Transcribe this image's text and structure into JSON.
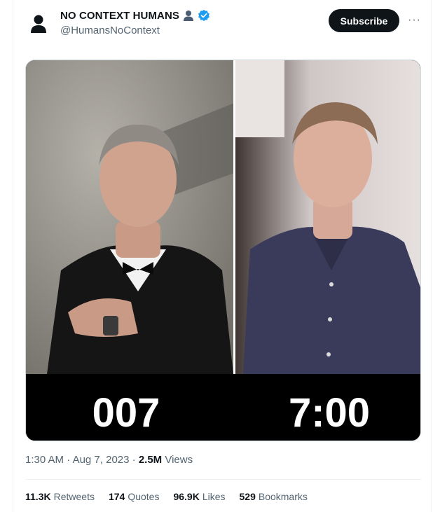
{
  "author": {
    "display_name": "NO CONTEXT HUMANS",
    "handle": "@HumansNoContext",
    "name_emoji": "person-silhouette-icon",
    "verified": true
  },
  "header": {
    "subscribe_label": "Subscribe",
    "more_icon": "more-options-icon",
    "more_glyph": "···"
  },
  "media": {
    "left_caption": "007",
    "right_caption": "7:00",
    "colors": {
      "caption_bg": "#000000",
      "caption_text": "#ffffff"
    }
  },
  "meta": {
    "time": "1:30 AM",
    "sep": "·",
    "date": "Aug 7, 2023",
    "views_count": "2.5M",
    "views_label": "Views"
  },
  "stats": [
    {
      "count": "11.3K",
      "label": "Retweets"
    },
    {
      "count": "174",
      "label": "Quotes"
    },
    {
      "count": "96.9K",
      "label": "Likes"
    },
    {
      "count": "529",
      "label": "Bookmarks"
    }
  ],
  "colors": {
    "accent": "#1d9bf0",
    "muted": "#536471",
    "text": "#0f1419"
  }
}
